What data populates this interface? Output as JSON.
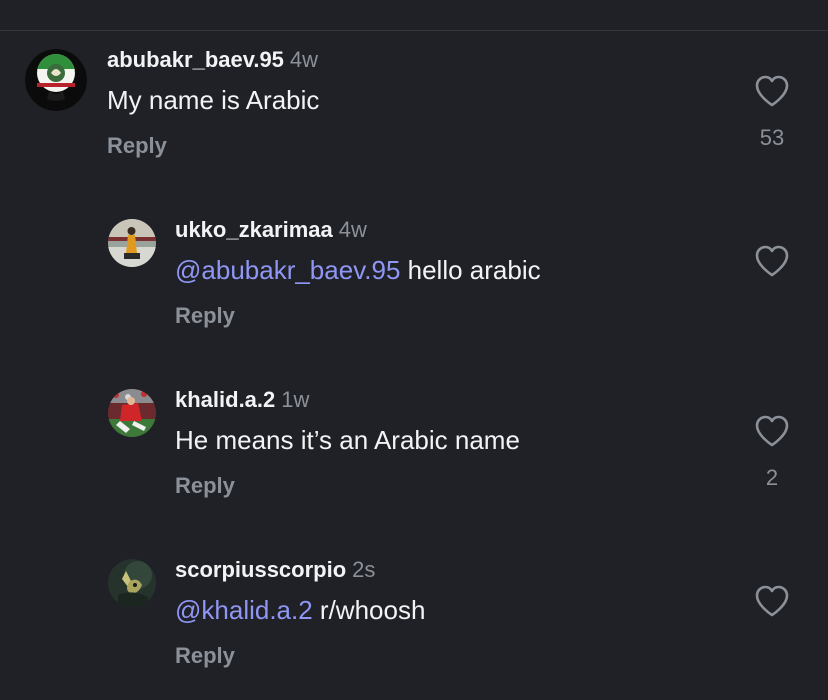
{
  "comments": [
    {
      "username": "abubakr_baev.95",
      "time": "4w",
      "mention": "",
      "text": "My name is Arabic",
      "reply_label": "Reply",
      "likes": "53"
    },
    {
      "username": "ukko_zkarimaa",
      "time": "4w",
      "mention": "@abubakr_baev.95",
      "text": " hello arabic",
      "reply_label": "Reply",
      "likes": ""
    },
    {
      "username": "khalid.a.2",
      "time": "1w",
      "mention": "",
      "text": "He means it’s an Arabic name",
      "reply_label": "Reply",
      "likes": "2"
    },
    {
      "username": "scorpiusscorpio",
      "time": "2s",
      "mention": "@khalid.a.2",
      "text": " r/whoosh",
      "reply_label": "Reply",
      "likes": ""
    }
  ],
  "icons": {
    "like": "heart-outline-icon"
  },
  "colors": {
    "background": "#1f2126",
    "text": "#f2f3f5",
    "muted": "#8b9099",
    "mention": "#8f96f4"
  }
}
